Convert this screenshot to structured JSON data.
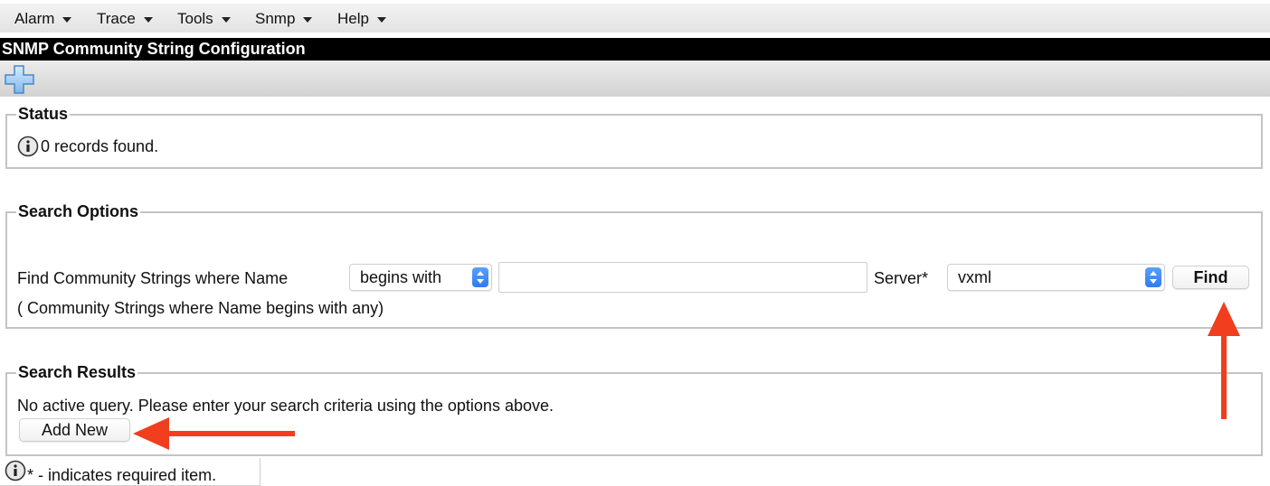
{
  "menu": {
    "items": [
      {
        "label": "Alarm"
      },
      {
        "label": "Trace"
      },
      {
        "label": "Tools"
      },
      {
        "label": "Snmp"
      },
      {
        "label": "Help"
      }
    ]
  },
  "page": {
    "title": "SNMP Community String Configuration",
    "toolbar": {
      "add_icon": "plus-icon"
    }
  },
  "status": {
    "legend": "Status",
    "message": "0 records found.",
    "icon": "info-icon"
  },
  "search_options": {
    "legend": "Search Options",
    "find_label": "Find Community Strings where Name",
    "match_select": {
      "selected": "begins with"
    },
    "name_input": {
      "value": "",
      "placeholder": ""
    },
    "server_label": "Server*",
    "server_select": {
      "selected": "vxml"
    },
    "find_button": "Find",
    "summary": "( Community Strings where Name begins with any)"
  },
  "search_results": {
    "legend": "Search Results",
    "message": "No active query. Please enter your search criteria using the options above.",
    "add_new_button": "Add New"
  },
  "footer": {
    "note": "* - indicates required item.",
    "icon": "info-icon"
  },
  "colors": {
    "title_bar": "#000000",
    "accent_blue": "#2f7bf0",
    "annotation_arrow": "#f03e1e"
  }
}
